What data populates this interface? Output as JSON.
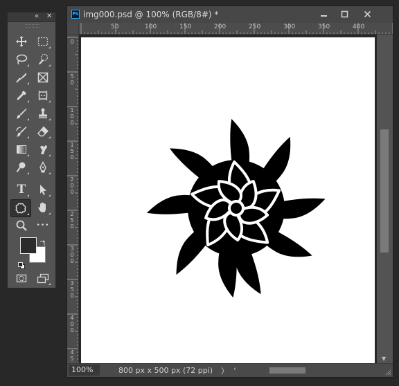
{
  "tools_panel": {
    "collapse_label": "«",
    "close_label": "✕",
    "tools": [
      {
        "name": "move-tool",
        "icon": "move-icon"
      },
      {
        "name": "marquee-tool",
        "icon": "rect-marquee-icon"
      },
      {
        "name": "lasso-tool",
        "icon": "lasso-icon"
      },
      {
        "name": "quick-select-tool",
        "icon": "quick-select-icon"
      },
      {
        "name": "crop-tool",
        "icon": "crop-icon"
      },
      {
        "name": "frame-tool",
        "icon": "frame-icon"
      },
      {
        "name": "eyedropper-tool",
        "icon": "eyedropper-icon"
      },
      {
        "name": "patch-tool",
        "icon": "patch-icon"
      },
      {
        "name": "brush-tool",
        "icon": "brush-icon"
      },
      {
        "name": "stamp-tool",
        "icon": "stamp-icon"
      },
      {
        "name": "history-brush-tool",
        "icon": "history-brush-icon"
      },
      {
        "name": "eraser-tool",
        "icon": "eraser-icon"
      },
      {
        "name": "gradient-tool",
        "icon": "gradient-icon"
      },
      {
        "name": "smudge-tool",
        "icon": "smudge-icon"
      },
      {
        "name": "dodge-tool",
        "icon": "dodge-icon"
      },
      {
        "name": "pen-tool",
        "icon": "pen-icon"
      },
      {
        "name": "type-tool",
        "icon": "type-icon",
        "glyph": "T"
      },
      {
        "name": "path-select-tool",
        "icon": "arrow-icon"
      },
      {
        "name": "custom-shape-tool",
        "icon": "custom-shape-icon",
        "active": true
      },
      {
        "name": "hand-tool",
        "icon": "hand-icon"
      },
      {
        "name": "zoom-tool",
        "icon": "zoom-icon"
      },
      {
        "name": "more-tools",
        "icon": "ellipsis-icon",
        "glyph": "•••"
      }
    ],
    "foreground_color": "#2b2b2b",
    "background_color": "#ffffff"
  },
  "document": {
    "ps_badge": "Ps",
    "title": "img000.psd @ 100% (RGB/8#) *",
    "ruler_h": [
      "0",
      "50",
      "100",
      "150",
      "200",
      "250",
      "300",
      "350",
      "400"
    ],
    "ruler_v": [
      "0",
      "5\n0",
      "1\n0\n0",
      "1\n5\n0",
      "2\n0\n0",
      "2\n5\n0",
      "3\n0\n0",
      "3\n5\n0",
      "4\n0\n0",
      "4\n5\n0"
    ],
    "zoom": "100%",
    "doc_info": "800 px x 500 px (72 ppi)",
    "status_arrow": "〉"
  },
  "colors": {
    "ui_bg": "#535353",
    "titlebar": "#474747",
    "accent_ps": "#31a8ff"
  }
}
